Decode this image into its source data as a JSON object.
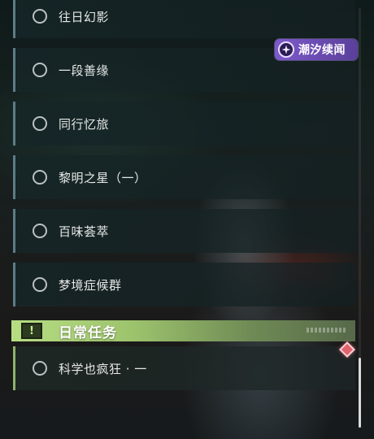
{
  "badge": {
    "label": "潮汐续闻",
    "icon": "tidal-star-icon",
    "color": "#6f4cc0"
  },
  "quests": [
    {
      "label": "往日幻影",
      "icon": "radio-circle-icon"
    },
    {
      "label": "一段善缘",
      "icon": "radio-circle-icon"
    },
    {
      "label": "同行忆旅",
      "icon": "radio-circle-icon"
    },
    {
      "label": "黎明之星（一）",
      "icon": "radio-circle-icon"
    },
    {
      "label": "百味荟萃",
      "icon": "radio-circle-icon"
    },
    {
      "label": "梦境症候群",
      "icon": "radio-circle-icon"
    }
  ],
  "daily_section": {
    "title": "日常任务",
    "icon": "exclamation-icon",
    "accent_color": "#a9d27a",
    "quests": [
      {
        "label": "科学也疯狂 · 一",
        "icon": "radio-circle-icon",
        "marker": "red-diamond-icon"
      }
    ]
  }
}
